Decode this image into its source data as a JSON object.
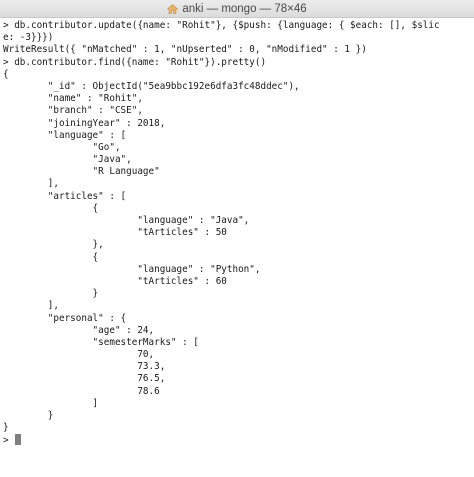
{
  "window": {
    "title": "anki — mongo — 78×46",
    "title_icon": "home-icon"
  },
  "terminal": {
    "lines": [
      "> db.contributor.update({name: \"Rohit\"}, {$push: {language: { $each: [], $slic",
      "e: -3}}})",
      "WriteResult({ \"nMatched\" : 1, \"nUpserted\" : 0, \"nModified\" : 1 })",
      "> db.contributor.find({name: \"Rohit\"}).pretty()",
      "{",
      "        \"_id\" : ObjectId(\"5ea9bbc192e6dfa3fc48ddec\"),",
      "        \"name\" : \"Rohit\",",
      "        \"branch\" : \"CSE\",",
      "        \"joiningYear\" : 2018,",
      "        \"language\" : [",
      "                \"Go\",",
      "                \"Java\",",
      "                \"R Language\"",
      "        ],",
      "        \"articles\" : [",
      "                {",
      "                        \"language\" : \"Java\",",
      "                        \"tArticles\" : 50",
      "                },",
      "                {",
      "                        \"language\" : \"Python\",",
      "                        \"tArticles\" : 60",
      "                }",
      "        ],",
      "        \"personal\" : {",
      "                \"age\" : 24,",
      "                \"semesterMarks\" : [",
      "                        70,",
      "                        73.3,",
      "                        76.5,",
      "                        78.6",
      "                ]",
      "        }",
      "}"
    ],
    "prompt": "> "
  }
}
